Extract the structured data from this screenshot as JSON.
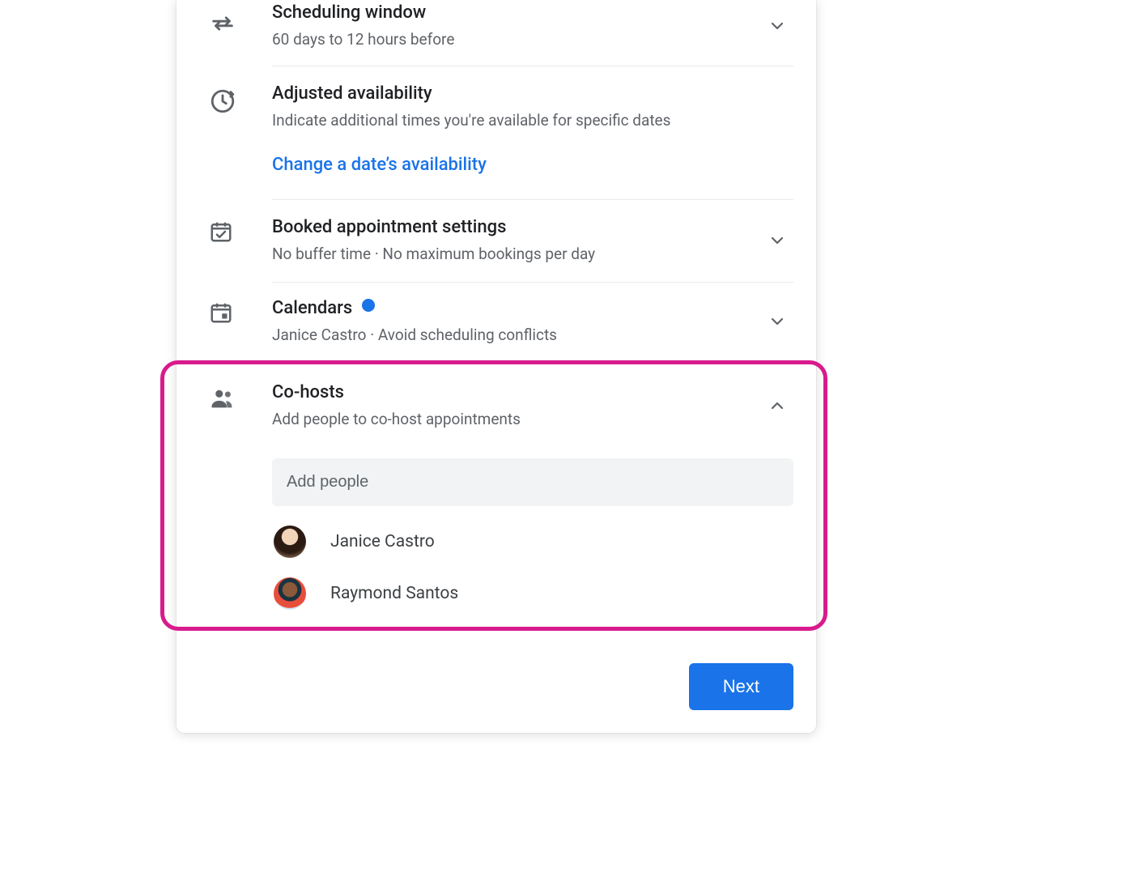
{
  "sections": {
    "scheduling": {
      "title": "Scheduling window",
      "subtitle": "60 days to 12 hours before"
    },
    "adjusted": {
      "title": "Adjusted availability",
      "subtitle": "Indicate additional times you're available for specific dates",
      "link": "Change a date’s availability"
    },
    "booked": {
      "title": "Booked appointment settings",
      "subtitle": "No buffer time · No maximum bookings per day"
    },
    "calendars": {
      "title": "Calendars",
      "subtitle": "Janice Castro · Avoid scheduling conflicts"
    },
    "cohosts": {
      "title": "Co-hosts",
      "subtitle": "Add people to co-host appointments",
      "input_placeholder": "Add people",
      "people": [
        {
          "name": "Janice Castro"
        },
        {
          "name": "Raymond Santos"
        }
      ]
    }
  },
  "footer": {
    "next_label": "Next"
  }
}
